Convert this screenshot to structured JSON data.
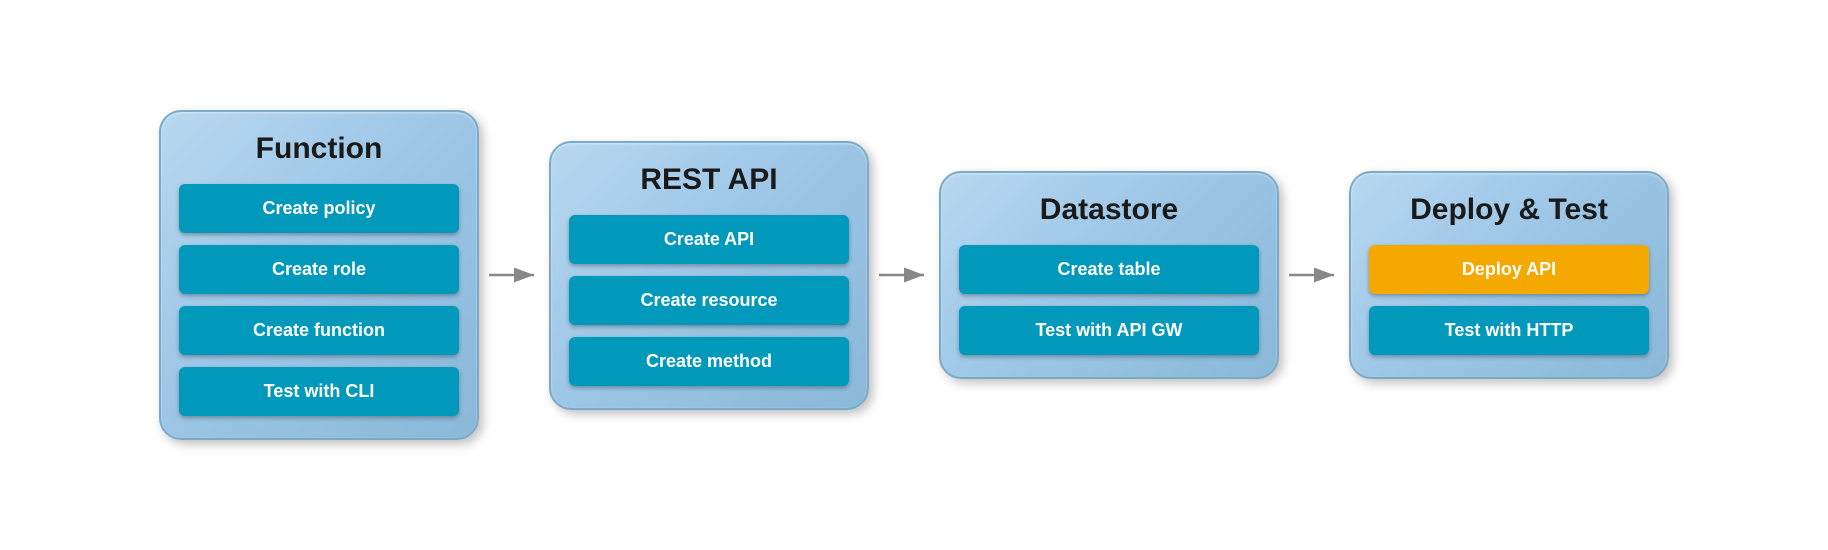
{
  "panels": [
    {
      "id": "function",
      "title": "Function",
      "buttons": [
        {
          "label": "Create policy",
          "style": "teal"
        },
        {
          "label": "Create role",
          "style": "teal"
        },
        {
          "label": "Create function",
          "style": "teal"
        },
        {
          "label": "Test with CLI",
          "style": "teal"
        }
      ]
    },
    {
      "id": "rest-api",
      "title": "REST API",
      "buttons": [
        {
          "label": "Create API",
          "style": "teal"
        },
        {
          "label": "Create resource",
          "style": "teal"
        },
        {
          "label": "Create method",
          "style": "teal"
        }
      ]
    },
    {
      "id": "datastore",
      "title": "Datastore",
      "buttons": [
        {
          "label": "Create table",
          "style": "teal"
        },
        {
          "label": "Test with API GW",
          "style": "teal"
        }
      ]
    },
    {
      "id": "deploy-test",
      "title": "Deploy & Test",
      "buttons": [
        {
          "label": "Deploy API",
          "style": "orange"
        },
        {
          "label": "Test with HTTP",
          "style": "teal"
        }
      ]
    }
  ],
  "arrows": [
    "→",
    "→",
    "→"
  ]
}
